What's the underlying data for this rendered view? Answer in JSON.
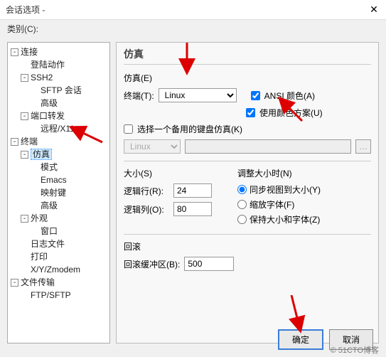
{
  "window": {
    "title": "会话选项 -"
  },
  "sidebar": {
    "label": "类别(C):",
    "tree": {
      "connect": "连接",
      "login": "登陆动作",
      "ssh2": "SSH2",
      "sftp": "SFTP 会话",
      "adv1": "高级",
      "portfwd": "端口转发",
      "remote": "远程/X11",
      "terminal": "终端",
      "emulation": "仿真",
      "mode": "模式",
      "emacs": "Emacs",
      "mapkey": "映射键",
      "adv2": "高级",
      "appearance": "外观",
      "window": "窗口",
      "logfile": "日志文件",
      "print": "打印",
      "xyz": "X/Y/Zmodem",
      "filetrans": "文件传输",
      "ftp": "FTP/SFTP"
    }
  },
  "main": {
    "title": "仿真",
    "emu_group": "仿真(E)",
    "terminal_label": "终端(T):",
    "terminal_value": "Linux",
    "ansi_color": "ANSI 颜色(A)",
    "use_scheme": "使用颜色方案(U)",
    "use_backup_kb": "选择一个备用的键盘仿真(K)",
    "kb_value": "Linux",
    "size_label": "大小(S)",
    "rows_label": "逻辑行(R):",
    "rows_value": "24",
    "cols_label": "逻辑列(O):",
    "cols_value": "80",
    "resize_label": "调整大小时(N)",
    "resize_opt1": "同步视图到大小(Y)",
    "resize_opt2": "缩放字体(F)",
    "resize_opt3": "保持大小和字体(Z)",
    "scrollback_group": "回滚",
    "scrollback_label": "回滚缓冲区(B):",
    "scrollback_value": "500"
  },
  "buttons": {
    "ok": "确定",
    "cancel": "取消"
  },
  "watermark": "© 51CTO博客"
}
